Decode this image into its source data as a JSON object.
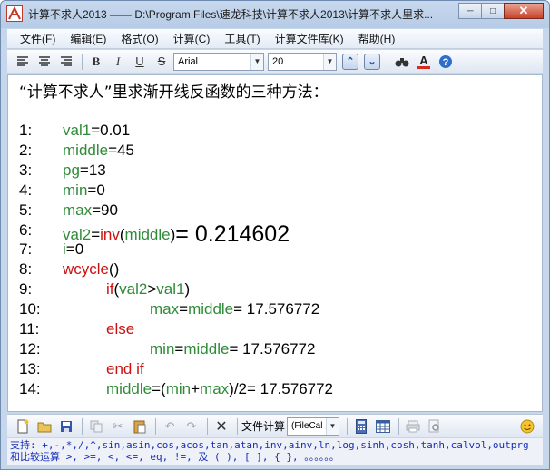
{
  "window": {
    "title": "计算不求人2013 —— D:\\Program Files\\速龙科技\\计算不求人2013\\计算不求人里求...",
    "buttons": {
      "minimize": "─",
      "maximize": "□",
      "close": "✕"
    }
  },
  "menu": [
    "文件(F)",
    "编辑(E)",
    "格式(O)",
    "计算(C)",
    "工具(T)",
    "计算文件库(K)",
    "帮助(H)"
  ],
  "format_toolbar": {
    "bold": "B",
    "italic": "I",
    "underline": "U",
    "strike": "S",
    "font": "Arial",
    "size": "20"
  },
  "editor": {
    "heading": "“计算不求人”里求渐开线反函数的三种方法：",
    "lines": [
      {
        "n": "1:",
        "indent": 0,
        "parts": [
          {
            "t": "val1",
            "c": "g"
          },
          {
            "t": "=0.01",
            "c": "k"
          }
        ]
      },
      {
        "n": "2:",
        "indent": 0,
        "parts": [
          {
            "t": "middle",
            "c": "g"
          },
          {
            "t": "=45",
            "c": "k"
          }
        ]
      },
      {
        "n": "3:",
        "indent": 0,
        "parts": [
          {
            "t": "pg",
            "c": "g"
          },
          {
            "t": "=13",
            "c": "k"
          }
        ]
      },
      {
        "n": "4:",
        "indent": 0,
        "parts": [
          {
            "t": "min",
            "c": "g"
          },
          {
            "t": "=0",
            "c": "k"
          }
        ]
      },
      {
        "n": "5:",
        "indent": 0,
        "parts": [
          {
            "t": "max",
            "c": "g"
          },
          {
            "t": "=90",
            "c": "k"
          }
        ]
      },
      {
        "n": "6:",
        "indent": 0,
        "parts": [
          {
            "t": "val2",
            "c": "g"
          },
          {
            "t": "=",
            "c": "k"
          },
          {
            "t": "inv",
            "c": "r"
          },
          {
            "t": "(",
            "c": "k"
          },
          {
            "t": "middle",
            "c": "g"
          },
          {
            "t": ")",
            "c": "k"
          },
          {
            "t": "= 0.214602",
            "c": "big"
          }
        ]
      },
      {
        "n": "7:",
        "indent": 0,
        "parts": [
          {
            "t": "i",
            "c": "g"
          },
          {
            "t": "=0",
            "c": "k"
          }
        ]
      },
      {
        "n": "8:",
        "indent": 0,
        "parts": [
          {
            "t": "wcycle",
            "c": "r"
          },
          {
            "t": "()",
            "c": "k"
          }
        ]
      },
      {
        "n": "9:",
        "indent": 1,
        "parts": [
          {
            "t": "if",
            "c": "r"
          },
          {
            "t": "(",
            "c": "k"
          },
          {
            "t": "val2",
            "c": "g"
          },
          {
            "t": ">",
            "c": "k"
          },
          {
            "t": "val1",
            "c": "g"
          },
          {
            "t": ")",
            "c": "k"
          }
        ]
      },
      {
        "n": "10:",
        "indent": 2,
        "parts": [
          {
            "t": "max",
            "c": "g"
          },
          {
            "t": "=",
            "c": "k"
          },
          {
            "t": "middle",
            "c": "g"
          },
          {
            "t": "= 17.576772",
            "c": "k"
          }
        ]
      },
      {
        "n": "11:",
        "indent": 1,
        "parts": [
          {
            "t": "else",
            "c": "r"
          }
        ]
      },
      {
        "n": "12:",
        "indent": 2,
        "parts": [
          {
            "t": "min",
            "c": "g"
          },
          {
            "t": "=",
            "c": "k"
          },
          {
            "t": "middle",
            "c": "g"
          },
          {
            "t": "= 17.576772",
            "c": "k"
          }
        ]
      },
      {
        "n": "13:",
        "indent": 1,
        "parts": [
          {
            "t": "end if",
            "c": "r"
          }
        ]
      },
      {
        "n": "14:",
        "indent": 1,
        "parts": [
          {
            "t": "middle",
            "c": "g"
          },
          {
            "t": "=(",
            "c": "k"
          },
          {
            "t": "min",
            "c": "g"
          },
          {
            "t": "+",
            "c": "k"
          },
          {
            "t": "max",
            "c": "g"
          },
          {
            "t": ")/2= 17.576772",
            "c": "k"
          }
        ]
      }
    ]
  },
  "bottom_toolbar": {
    "file_calc_label": "文件计算",
    "file_calc_combo": "(FileCal"
  },
  "support_text": "支持: +,-,*,/,^,sin,asin,cos,acos,tan,atan,inv,ainv,ln,log,sinh,cosh,tanh,calvol,outprg 和比较运算 >, >=, <, <=, eq, !=, 及 ( ), [ ], { }, 。。。。。。",
  "colors": {
    "accent": "#2e8b38",
    "keyword": "#cc1111",
    "support": "#1a2fb5"
  }
}
